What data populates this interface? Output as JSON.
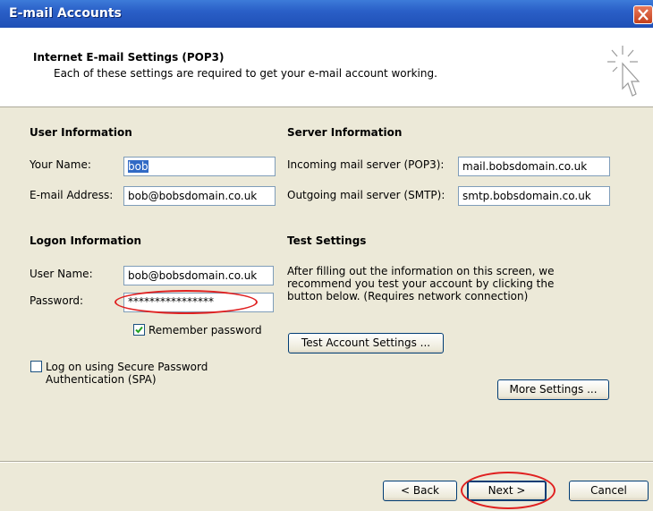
{
  "window": {
    "title": "E-mail Accounts"
  },
  "header": {
    "title": "Internet E-mail Settings (POP3)",
    "subtitle": "Each of these settings are required to get your e-mail account working."
  },
  "user_info": {
    "heading": "User Information",
    "name_label": "Your Name:",
    "name_value": "bob",
    "email_label": "E-mail Address:",
    "email_value": "bob@bobsdomain.co.uk"
  },
  "server_info": {
    "heading": "Server Information",
    "incoming_label": "Incoming mail server (POP3):",
    "incoming_value": "mail.bobsdomain.co.uk",
    "outgoing_label": "Outgoing mail server (SMTP):",
    "outgoing_value": "smtp.bobsdomain.co.uk"
  },
  "logon_info": {
    "heading": "Logon Information",
    "username_label": "User Name:",
    "username_value": "bob@bobsdomain.co.uk",
    "password_label": "Password:",
    "password_value": "****************",
    "remember_label": "Remember password",
    "remember_checked": true,
    "spa_label_line1": "Log on using Secure Password",
    "spa_label_line2": "Authentication (SPA)",
    "spa_checked": false
  },
  "test_settings": {
    "heading": "Test Settings",
    "description": "After filling out the information on this screen, we recommend you test your account by clicking the button below. (Requires network connection)",
    "test_button": "Test Account Settings ...",
    "more_button": "More Settings ..."
  },
  "footer": {
    "back_button": "< Back",
    "next_button": "Next >",
    "cancel_button": "Cancel"
  },
  "colors": {
    "titlebar": "#2a5fc7",
    "dialog_bg": "#ece9d8",
    "annotation": "#e02020"
  }
}
